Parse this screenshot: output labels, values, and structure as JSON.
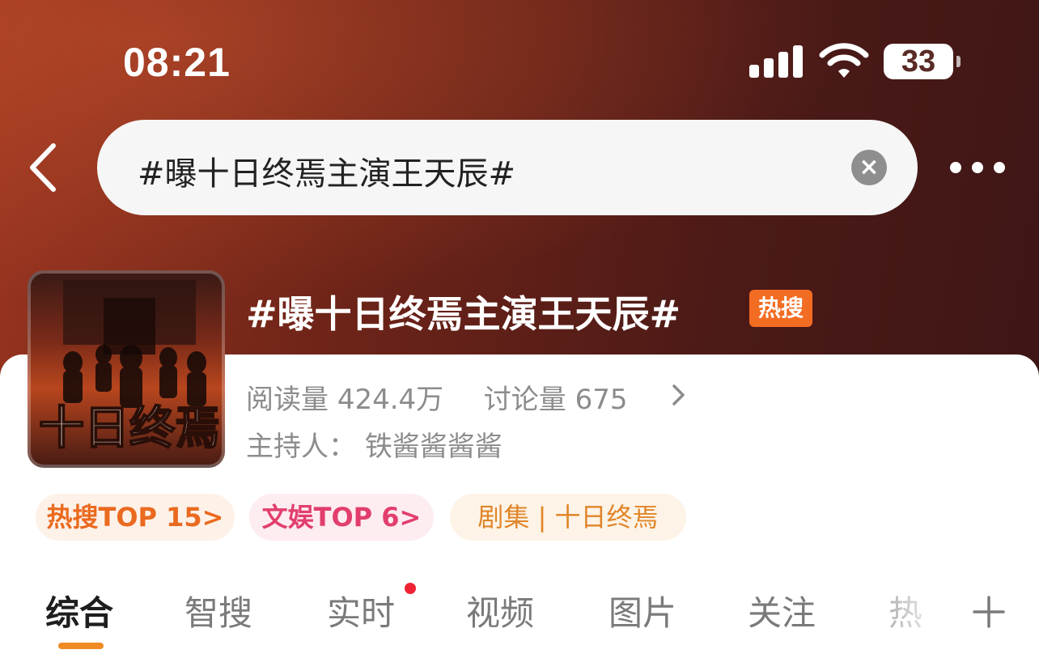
{
  "status_bar": {
    "time": "08:21",
    "battery": "33",
    "icons": [
      "signal-icon",
      "wifi-icon",
      "battery-icon"
    ]
  },
  "search": {
    "query": "#曝十日终焉主演王天辰#",
    "icons": [
      "back-arrow-icon",
      "clear-icon",
      "more-icon"
    ]
  },
  "topic": {
    "title": "#曝十日终焉主演王天辰#",
    "badge": "热搜",
    "reads_label": "阅读量",
    "reads_value": "424.4万",
    "discussions_label": "讨论量",
    "discussions_value": "675",
    "host_label": "主持人：",
    "host_name": "铁酱酱酱酱",
    "cover_text": "十日终焉"
  },
  "tags": [
    {
      "label": "热搜TOP 15",
      "suffix": ">",
      "color": "#ea6a1f"
    },
    {
      "label": "文娱TOP 6",
      "suffix": ">",
      "color": "#e23e6d"
    },
    {
      "label": "剧集 | 十日终焉",
      "suffix": "",
      "color": "#e1862a"
    }
  ],
  "tabs": [
    {
      "label": "综合",
      "active": true
    },
    {
      "label": "智搜",
      "active": false
    },
    {
      "label": "实时",
      "active": false,
      "has_dot": true
    },
    {
      "label": "视频",
      "active": false
    },
    {
      "label": "图片",
      "active": false
    },
    {
      "label": "关注",
      "active": false
    },
    {
      "label": "热",
      "active": false
    }
  ],
  "colors": {
    "accent": "#f08a24",
    "hot_badge": "#f26c22",
    "header_dark": "#4c1a17"
  }
}
